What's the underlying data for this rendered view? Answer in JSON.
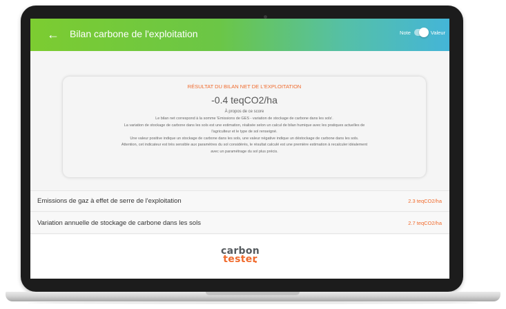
{
  "appbar": {
    "title": "Bilan carbone de l'exploitation",
    "toggle_left": "Note",
    "toggle_right": "Valeur"
  },
  "result": {
    "title": "RÉSULTAT DU BILAN NET DE L'EXPLOITATION",
    "value": "-0.4 teqCO2/ha",
    "about_title": "À propos de ce score",
    "lines": [
      "Le bilan net correspond à la somme 'Emissions de GES - variation de stockage de carbone dans les sols'.",
      "La variation de stockage de carbone dans les sols est une estimation, réalisée selon un calcul de bilan humique avec les pratiques actuelles de",
      "l'agriculteur et le type de sol renseigné.",
      "Une valeur positive indique un stockage de carbone dans les sols, une valeur négative indique un déstockage de carbone dans les sols.",
      "Attention, cet indicateur est très sensible aux paramètres du sol considérés, le résultat calculé est une première estimation à recalculer idéalement",
      "avec un paramétrage du sol plus précis."
    ]
  },
  "rows": [
    {
      "label": "Emissions de gaz à effet de serre de l'exploitation",
      "value": "2.3 teqCO2/ha"
    },
    {
      "label": "Variation annuelle de stockage de carbone dans les sols",
      "value": "2.7 teqCO2/ha"
    }
  ],
  "footer": {
    "logo_line1": "carbon",
    "logo_line2": "tester"
  },
  "icons": {
    "back": "arrow-left-icon",
    "toggle": "toggle-switch"
  },
  "colors": {
    "gradient_start": "#7ccc31",
    "gradient_end": "#44b5d8",
    "accent": "#f06a2c",
    "text": "#333333"
  }
}
